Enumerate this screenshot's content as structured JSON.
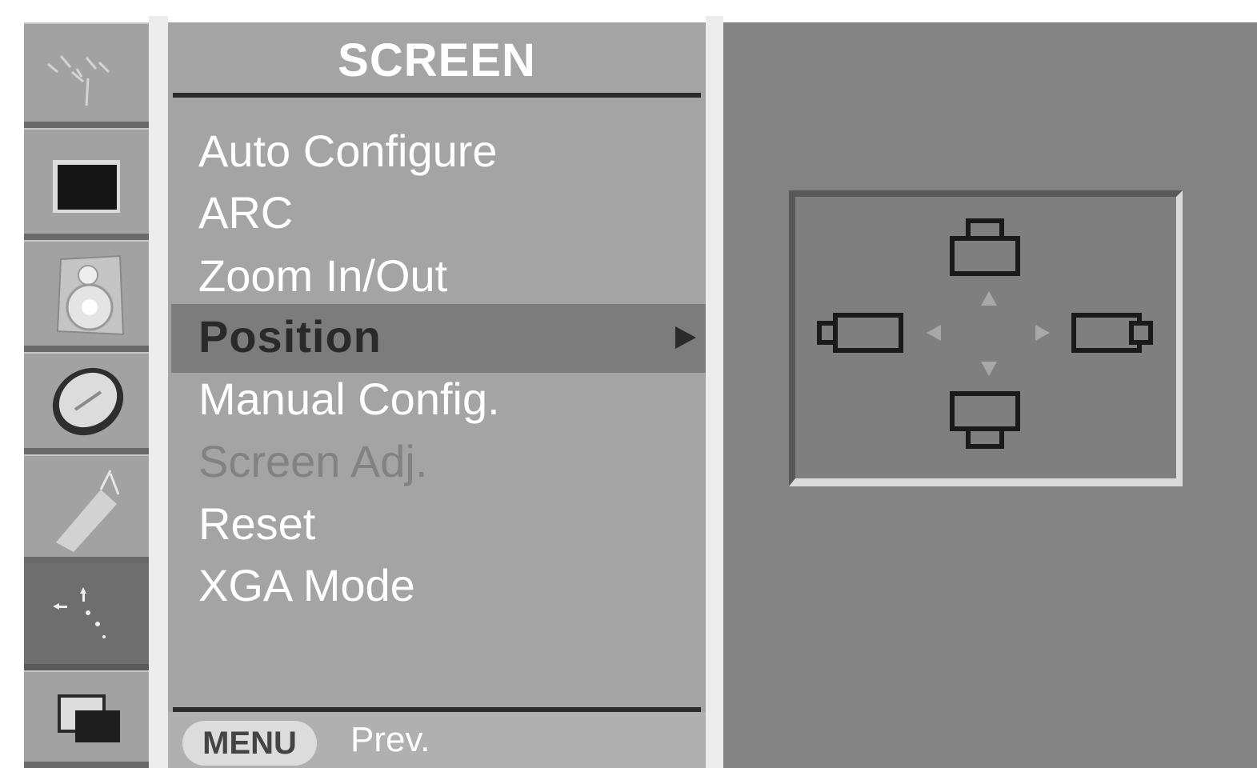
{
  "menu": {
    "title": "SCREEN",
    "items": [
      {
        "label": "Auto Configure",
        "state": "normal"
      },
      {
        "label": "ARC",
        "state": "normal"
      },
      {
        "label": "Zoom In/Out",
        "state": "normal"
      },
      {
        "label": "Position",
        "state": "selected"
      },
      {
        "label": "Manual Config.",
        "state": "normal"
      },
      {
        "label": "Screen Adj.",
        "state": "disabled"
      },
      {
        "label": "Reset",
        "state": "normal"
      },
      {
        "label": "XGA Mode",
        "state": "normal"
      }
    ]
  },
  "footer": {
    "menu_button_label": "MENU",
    "prev_label": "Prev."
  },
  "sidebar": {
    "icons": [
      "channel-icon",
      "picture-icon",
      "sound-icon",
      "time-icon",
      "option-icon",
      "screen-icon",
      "pip-icon"
    ],
    "active": "screen-icon"
  },
  "position_panel": {
    "icons": [
      "position-up-icon",
      "position-left-icon",
      "position-right-icon",
      "position-down-icon"
    ]
  }
}
